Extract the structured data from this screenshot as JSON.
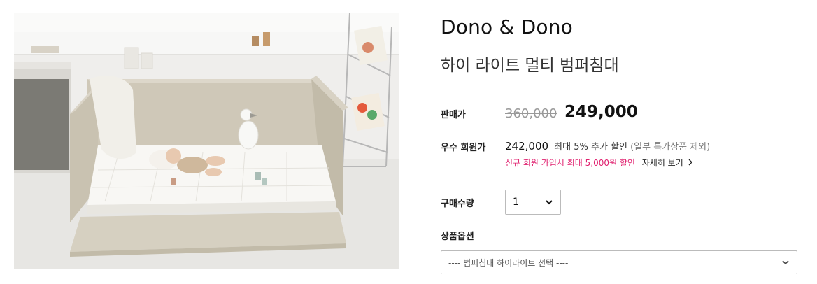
{
  "product": {
    "brand": "Dono & Dono",
    "name": "하이 라이트 멀티 범퍼침대",
    "image_alt": "product-photo"
  },
  "pricing": {
    "label": "판매가",
    "original": "360,000",
    "sale": "249,000"
  },
  "member": {
    "label": "우수 회원가",
    "price": "242,000",
    "discount": "최대 5% 추가 할인",
    "note": "(일부 특가상품 제외)",
    "promo": "신규 회원 가입시 최대 5,000원 할인",
    "detail_link": "자세히 보기"
  },
  "quantity": {
    "label": "구매수량",
    "value": "1"
  },
  "options": {
    "label": "상품옵션",
    "placeholder": "---- 범퍼침대 하이라이트 선택 ----"
  },
  "colors": {
    "promo": "#e0216f",
    "bumper": "#cfc8b8",
    "wall": "#f1f0ee"
  },
  "icons": {
    "select_arrow": "chevron-down-icon",
    "detail_arrow": "chevron-right-icon"
  }
}
